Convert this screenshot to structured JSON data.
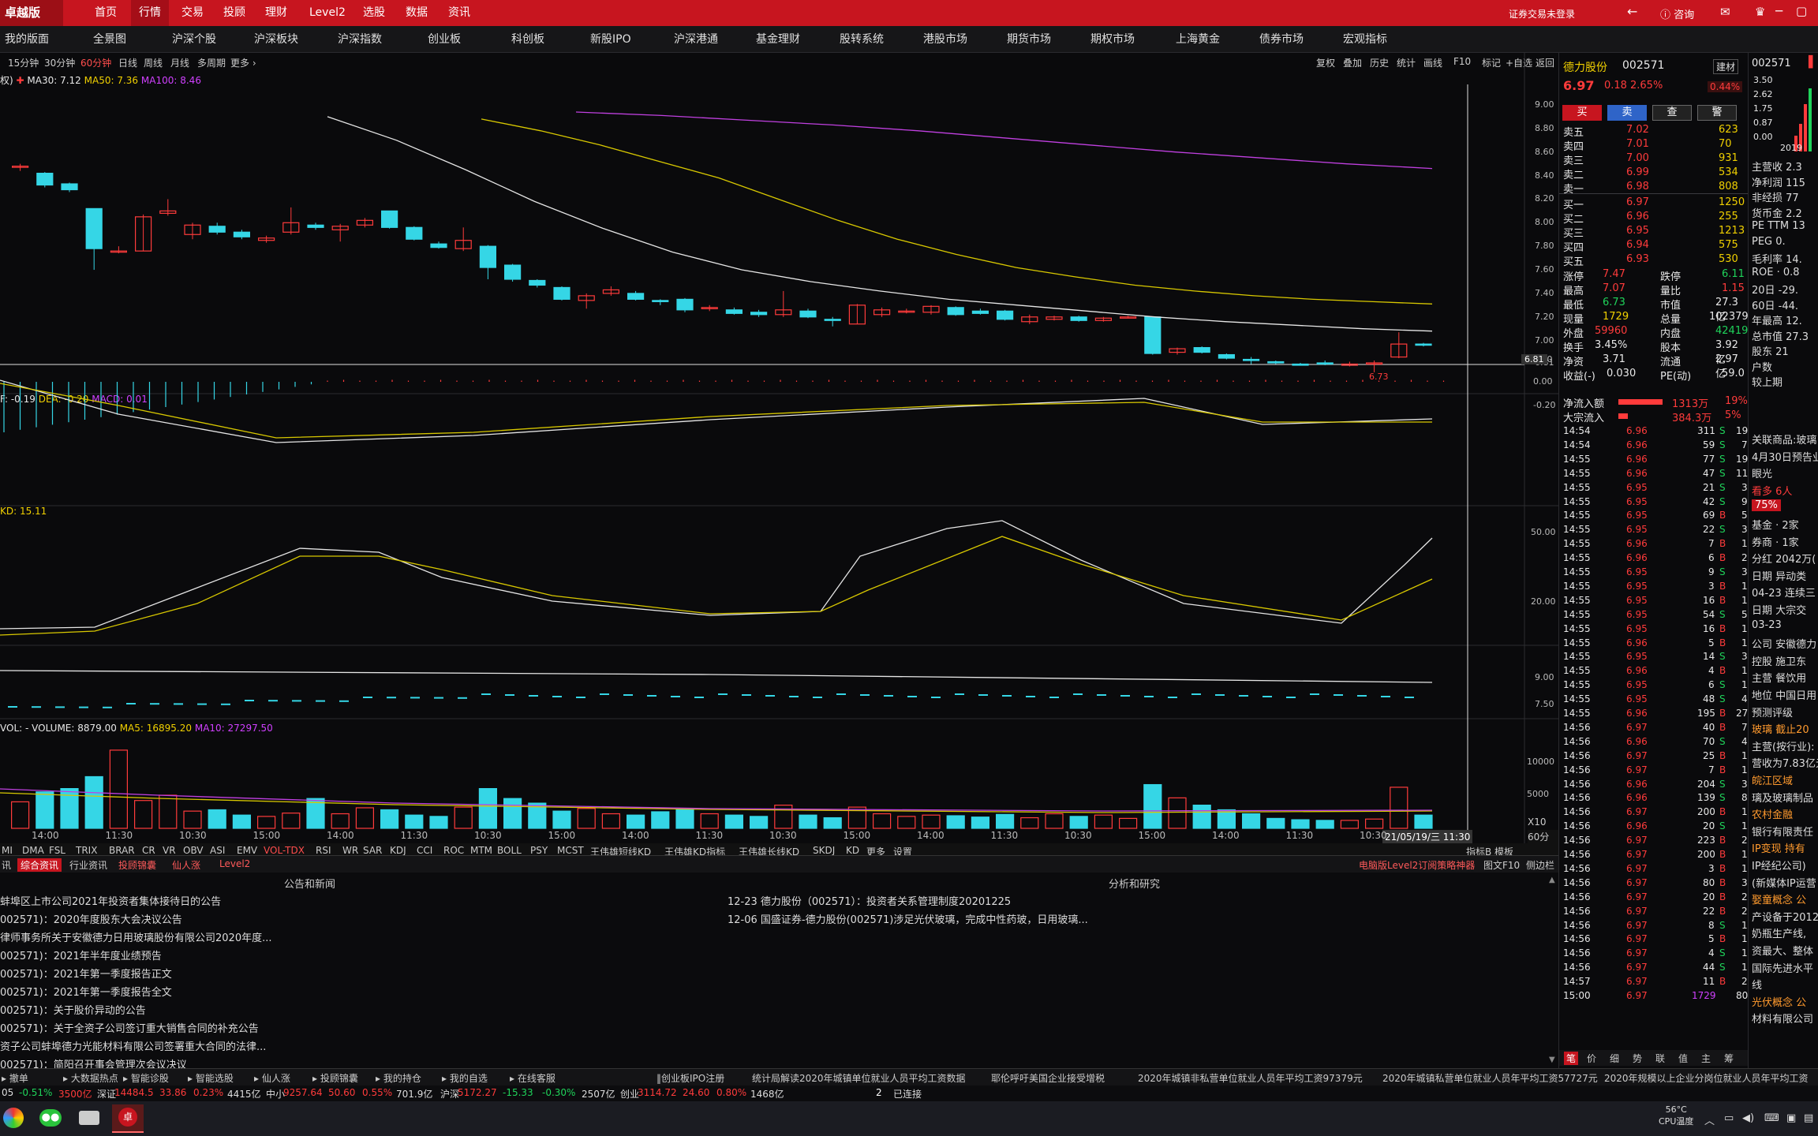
{
  "app": {
    "logo": "卓越版",
    "menu": [
      "首页",
      "行情",
      "交易",
      "投顾",
      "理财",
      "Level2",
      "选股",
      "数据",
      "资讯"
    ],
    "active_menu": "行情",
    "login_text": "证券交易未登录",
    "consult": "咨询"
  },
  "nav": [
    "我的版面",
    "全景图",
    "沪深个股",
    "沪深板块",
    "沪深指数",
    "创业板",
    "科创板",
    "新股IPO",
    "沪深港通",
    "基金理财",
    "股转系统",
    "港股市场",
    "期货市场",
    "期权市场",
    "上海黄金",
    "债券市场",
    "宏观指标"
  ],
  "periods": [
    "15分钟",
    "30分钟",
    "60分钟",
    "日线",
    "周线",
    "月线",
    "多周期",
    "更多 ›"
  ],
  "active_period": "60分钟",
  "chart_tools": [
    "复权",
    "叠加",
    "历史",
    "统计",
    "画线",
    "F10",
    "标记",
    "+自选",
    "返回"
  ],
  "ma_line": {
    "prefix": "权)",
    "ma30": "MA30: 7.12",
    "ma50": "MA50: 7.36",
    "ma100": "MA100: 8.46"
  },
  "macd_line": {
    "dif": "F: -0.19",
    "dea": "DEA: -0.20",
    "macd": "MACD: 0.01"
  },
  "kd_line": "KD: 15.11",
  "vol_line": {
    "vol": "VOL: - VOLUME: 8879.00",
    "ma5": "MA5: 16895.20",
    "ma10": "MA10: 27297.50"
  },
  "y_price": [
    "9.00",
    "8.80",
    "8.60",
    "8.40",
    "8.20",
    "8.00",
    "7.80",
    "7.60",
    "7.40",
    "7.20",
    "7.00",
    "6.81"
  ],
  "y_macd": [
    "0.20",
    "0.00",
    "-0.20"
  ],
  "y_kd": [
    "50.00",
    "20.00"
  ],
  "y_other": [
    "9.00",
    "7.50"
  ],
  "y_vol": [
    "10000",
    "5000"
  ],
  "vol_unit": "X10",
  "x_ticks": [
    "14:00",
    "11:30",
    "10:30",
    "15:00",
    "14:00",
    "11:30",
    "10:30",
    "15:00",
    "14:00",
    "11:30",
    "10:30",
    "15:00",
    "14:00",
    "11:30",
    "10:30",
    "15:00",
    "14:00",
    "11:30",
    "10:30"
  ],
  "crosshair_date": "21/05/19/三 11:30",
  "cross_price": "6.81",
  "low_label": "6.73",
  "period_label": "60分钟",
  "mode_tabs": [
    "指标B",
    "模板"
  ],
  "indicator_tabs": [
    "MI",
    "DMA",
    "FSL",
    "TRIX",
    "BRAR",
    "CR",
    "VR",
    "OBV",
    "ASI",
    "EMV",
    "VOL-TDX",
    "RSI",
    "WR",
    "SAR",
    "KDJ",
    "CCI",
    "ROC",
    "MTM",
    "BOLL",
    "PSY",
    "MCST",
    "王伟雄短线KD",
    "王伟雄KD指标",
    "王伟雄长线KD",
    "SKDJ",
    "KD",
    "更多",
    "设置"
  ],
  "bottom_tabs": [
    "讯",
    "综合资讯",
    "行业资讯",
    "投顾锦囊",
    "仙人涨",
    "Level2"
  ],
  "bottom_right": [
    "电脑版Level2订阅策略神器",
    "图文F10",
    "侧边栏"
  ],
  "news": {
    "left_title": "公告和新闻",
    "right_title": "分析和研究",
    "left": [
      "蚌埠区上市公司2021年投资者集体接待日的公告",
      "002571)：2020年度股东大会决议公告",
      "律师事务所关于安徽德力日用玻璃股份有限公司2020年度...",
      "002571)：2021年半年度业绩预告",
      "002571)：2021年第一季度报告正文",
      "002571)：2021年第一季度报告全文",
      "002571)：关于股价异动的公告",
      "002571)：关于全资子公司签订重大销售合同的补充公告",
      "资子公司蚌埠德力光能材料有限公司签署重大合同的法律...",
      "002571)：简阳召开事会管理次会议决议"
    ],
    "right": [
      "12-23 德力股份（002571）：投资者关系管理制度20201225",
      "12-06 国盛证券-德力股份(002571)涉足光伏玻璃，完成中性药玻，日用玻璃..."
    ]
  },
  "quote": {
    "name": "德力股份",
    "code": "002571",
    "sector": "建材",
    "price": "6.97",
    "change": "0.18",
    "pct": "2.65%",
    "side_pct": "0.44%",
    "buttons": [
      "买",
      "卖",
      "查",
      "警"
    ],
    "sell": [
      [
        "卖五",
        "7.02",
        "623"
      ],
      [
        "卖四",
        "7.01",
        "70"
      ],
      [
        "卖三",
        "7.00",
        "931"
      ],
      [
        "卖二",
        "6.99",
        "534"
      ],
      [
        "卖一",
        "6.98",
        "808"
      ]
    ],
    "buy": [
      [
        "买一",
        "6.97",
        "1250"
      ],
      [
        "买二",
        "6.96",
        "255"
      ],
      [
        "买三",
        "6.95",
        "1213"
      ],
      [
        "买四",
        "6.94",
        "575"
      ],
      [
        "买五",
        "6.93",
        "530"
      ]
    ],
    "stats": [
      [
        "涨停",
        "7.47",
        "跌停",
        "6.11"
      ],
      [
        "最高",
        "7.07",
        "量比",
        "1.15"
      ],
      [
        "最低",
        "6.73",
        "市值",
        "27.3亿"
      ],
      [
        "现量",
        "1729",
        "总量",
        "102379"
      ],
      [
        "外盘",
        "59960",
        "内盘",
        "42419"
      ],
      [
        "换手",
        "3.45%",
        "股本",
        "3.92亿"
      ],
      [
        "净资",
        "3.71",
        "流通",
        "2.97亿"
      ],
      [
        "收益(-)",
        "0.030",
        "PE(动)",
        "59.0"
      ]
    ],
    "flow": [
      [
        "净流入额",
        "1313万",
        "19%"
      ],
      [
        "大宗流入",
        "384.3万",
        "5%"
      ]
    ]
  },
  "ticks": [
    [
      "14:54",
      "6.96",
      "311",
      "S",
      "19"
    ],
    [
      "14:54",
      "6.96",
      "59",
      "S",
      "7"
    ],
    [
      "14:55",
      "6.96",
      "77",
      "S",
      "19"
    ],
    [
      "14:55",
      "6.96",
      "47",
      "S",
      "11"
    ],
    [
      "14:55",
      "6.95",
      "21",
      "S",
      "3"
    ],
    [
      "14:55",
      "6.95",
      "42",
      "S",
      "9"
    ],
    [
      "14:55",
      "6.95",
      "69",
      "B",
      "5"
    ],
    [
      "14:55",
      "6.95",
      "22",
      "S",
      "3"
    ],
    [
      "14:55",
      "6.96",
      "7",
      "B",
      "1"
    ],
    [
      "14:55",
      "6.96",
      "6",
      "B",
      "2"
    ],
    [
      "14:55",
      "6.95",
      "9",
      "S",
      "3"
    ],
    [
      "14:55",
      "6.95",
      "3",
      "B",
      "1"
    ],
    [
      "14:55",
      "6.95",
      "16",
      "B",
      "1"
    ],
    [
      "14:55",
      "6.95",
      "54",
      "S",
      "5"
    ],
    [
      "14:55",
      "6.95",
      "16",
      "B",
      "1"
    ],
    [
      "14:55",
      "6.96",
      "5",
      "B",
      "1"
    ],
    [
      "14:55",
      "6.95",
      "14",
      "S",
      "3"
    ],
    [
      "14:55",
      "6.96",
      "4",
      "B",
      "1"
    ],
    [
      "14:55",
      "6.95",
      "6",
      "S",
      "1"
    ],
    [
      "14:55",
      "6.95",
      "48",
      "S",
      "4"
    ],
    [
      "14:55",
      "6.96",
      "195",
      "B",
      "27"
    ],
    [
      "14:56",
      "6.97",
      "40",
      "B",
      "7"
    ],
    [
      "14:56",
      "6.96",
      "70",
      "S",
      "4"
    ],
    [
      "14:56",
      "6.97",
      "25",
      "B",
      "1"
    ],
    [
      "14:56",
      "6.97",
      "7",
      "B",
      "1"
    ],
    [
      "14:56",
      "6.96",
      "204",
      "S",
      "3"
    ],
    [
      "14:56",
      "6.96",
      "139",
      "S",
      "8"
    ],
    [
      "14:56",
      "6.97",
      "200",
      "B",
      "1"
    ],
    [
      "14:56",
      "6.96",
      "20",
      "S",
      "1"
    ],
    [
      "14:56",
      "6.97",
      "223",
      "B",
      "2"
    ],
    [
      "14:56",
      "6.97",
      "200",
      "B",
      "1"
    ],
    [
      "14:56",
      "6.97",
      "3",
      "B",
      "1"
    ],
    [
      "14:56",
      "6.97",
      "80",
      "B",
      "3"
    ],
    [
      "14:56",
      "6.97",
      "20",
      "B",
      "2"
    ],
    [
      "14:56",
      "6.97",
      "22",
      "B",
      "2"
    ],
    [
      "14:56",
      "6.97",
      "8",
      "S",
      "1"
    ],
    [
      "14:56",
      "6.97",
      "5",
      "B",
      "1"
    ],
    [
      "14:56",
      "6.97",
      "4",
      "S",
      "1"
    ],
    [
      "14:56",
      "6.97",
      "44",
      "S",
      "1"
    ],
    [
      "14:57",
      "6.97",
      "11",
      "B",
      "2"
    ],
    [
      "15:00",
      "6.97",
      "1729",
      "",
      "80"
    ]
  ],
  "right_tabs": [
    "笔",
    "价",
    "细",
    "势",
    "联",
    "值",
    "主",
    "筹"
  ],
  "far": {
    "code": "002571",
    "y": [
      "3.50",
      "2.62",
      "1.75",
      "0.87",
      "0.00"
    ],
    "year": "2019",
    "rows": [
      "主营收 2.3",
      "净利润 115",
      "非经损 77",
      "货币金 2.2",
      "PE TTM 13",
      "PEG 0.",
      "毛利率 14.",
      "ROE · 0.8",
      "20日 -29.",
      "60日 -44.",
      "年最高 12.",
      "总市值 27.3",
      "股东 21",
      "户数",
      "较上期"
    ],
    "extra": [
      "关联商品:玻璃",
      "4月30日预告业",
      "眼光",
      "看多 6人",
      "75%",
      "基金 · 2家",
      "券商 · 1家",
      "分红 2042万(",
      "日期 异动类",
      "04-23 连续三",
      "日期 大宗交",
      "03-23",
      "公司 安徽德力",
      "控股 施卫东",
      "主营 餐饮用",
      "地位 中国日用",
      "预测评级",
      "玻璃 截止20",
      "主营(按行业):",
      "营收为7.83亿元",
      "皖江区域",
      "璃及玻璃制品",
      "农村金融",
      "银行有限责任",
      "IP变现 持有",
      "IP经纪公司)",
      "(新媒体IP运营",
      "娶童概念 公",
      "产设备于2012",
      "奶瓶生产线,",
      "资最大、整体",
      "国际先进水平",
      "线",
      "光伏概念 公",
      "材料有限公司"
    ]
  },
  "ticker": [
    "‖创业板IPO注册",
    "统计局解读2020年城镇单位就业人员平均工资数据",
    "耶伦呼吁美国企业接受增税",
    "2020年城镇非私营单位就业人员年平均工资97379元",
    "2020年城镇私营单位就业人员年平均工资57727元",
    "2020年规模以上企业分岗位就业人员年平均工资"
  ],
  "statusbar": [
    "撤单",
    "大数据热点",
    "智能诊股",
    "智能选股",
    "仙人涨",
    "投顾锦囊",
    "我的持仓",
    "我的自选",
    "在线客服"
  ],
  "indexbar": {
    "items": [
      [
        "05",
        "-0.51%",
        "3500亿"
      ],
      [
        "深证",
        "14484.5",
        "33.86",
        "0.23%",
        "4415亿"
      ],
      [
        "中小",
        "9257.64",
        "50.60",
        "0.55%",
        "701.9亿"
      ],
      [
        "沪深",
        "5172.27",
        "-15.33",
        "-0.30%",
        "2507亿"
      ],
      [
        "创业",
        "3114.72",
        "24.60",
        "0.80%",
        "1468亿"
      ]
    ],
    "connected": "已连接",
    "two": "2"
  },
  "tray": {
    "temp": "56°C",
    "cpu": "CPU温度"
  },
  "colors": {
    "up": "#ff3b3b",
    "down": "#35d6e6",
    "ma30": "#e6e6e6",
    "ma50": "#d8c800",
    "ma100": "#c040e0",
    "brand": "#c7151f"
  },
  "candles": [
    {
      "o": 8.48,
      "c": 8.48,
      "h": 8.5,
      "l": 8.44
    },
    {
      "o": 8.42,
      "c": 8.32,
      "h": 8.43,
      "l": 8.3
    },
    {
      "o": 8.33,
      "c": 8.28,
      "h": 8.34,
      "l": 8.26
    },
    {
      "o": 8.12,
      "c": 7.78,
      "h": 8.12,
      "l": 7.6
    },
    {
      "o": 7.76,
      "c": 7.76,
      "h": 7.8,
      "l": 7.74
    },
    {
      "o": 7.76,
      "c": 8.05,
      "h": 8.07,
      "l": 7.76
    },
    {
      "o": 8.08,
      "c": 8.1,
      "h": 8.2,
      "l": 8.06
    },
    {
      "o": 7.9,
      "c": 7.98,
      "h": 8.0,
      "l": 7.86
    },
    {
      "o": 7.97,
      "c": 7.92,
      "h": 8.0,
      "l": 7.9
    },
    {
      "o": 7.92,
      "c": 7.88,
      "h": 7.94,
      "l": 7.86
    },
    {
      "o": 7.85,
      "c": 7.87,
      "h": 7.89,
      "l": 7.83
    },
    {
      "o": 7.92,
      "c": 8.0,
      "h": 8.13,
      "l": 7.9
    },
    {
      "o": 7.98,
      "c": 7.96,
      "h": 8.0,
      "l": 7.94
    },
    {
      "o": 7.94,
      "c": 7.97,
      "h": 7.99,
      "l": 7.84
    },
    {
      "o": 7.98,
      "c": 8.02,
      "h": 8.04,
      "l": 7.96
    },
    {
      "o": 8.1,
      "c": 7.96,
      "h": 8.1,
      "l": 7.95
    },
    {
      "o": 7.96,
      "c": 7.86,
      "h": 7.97,
      "l": 7.85
    },
    {
      "o": 7.82,
      "c": 7.79,
      "h": 7.84,
      "l": 7.78
    },
    {
      "o": 7.78,
      "c": 7.85,
      "h": 7.96,
      "l": 7.76
    },
    {
      "o": 7.8,
      "c": 7.62,
      "h": 7.81,
      "l": 7.52
    },
    {
      "o": 7.64,
      "c": 7.52,
      "h": 7.65,
      "l": 7.5
    },
    {
      "o": 7.51,
      "c": 7.47,
      "h": 7.52,
      "l": 7.45
    },
    {
      "o": 7.45,
      "c": 7.35,
      "h": 7.46,
      "l": 7.34
    },
    {
      "o": 7.34,
      "c": 7.38,
      "h": 7.4,
      "l": 7.27
    },
    {
      "o": 7.4,
      "c": 7.43,
      "h": 7.46,
      "l": 7.38
    },
    {
      "o": 7.4,
      "c": 7.35,
      "h": 7.42,
      "l": 7.34
    },
    {
      "o": 7.34,
      "c": 7.33,
      "h": 7.35,
      "l": 7.3
    },
    {
      "o": 7.35,
      "c": 7.26,
      "h": 7.36,
      "l": 7.24
    },
    {
      "o": 7.28,
      "c": 7.28,
      "h": 7.3,
      "l": 7.25
    },
    {
      "o": 7.26,
      "c": 7.23,
      "h": 7.28,
      "l": 7.22
    },
    {
      "o": 7.24,
      "c": 7.22,
      "h": 7.26,
      "l": 7.2
    },
    {
      "o": 7.22,
      "c": 7.26,
      "h": 7.42,
      "l": 7.2
    },
    {
      "o": 7.25,
      "c": 7.2,
      "h": 7.27,
      "l": 7.19
    },
    {
      "o": 7.18,
      "c": 7.17,
      "h": 7.2,
      "l": 7.12
    },
    {
      "o": 7.14,
      "c": 7.3,
      "h": 7.31,
      "l": 7.14
    },
    {
      "o": 7.22,
      "c": 7.26,
      "h": 7.28,
      "l": 7.2
    },
    {
      "o": 7.25,
      "c": 7.25,
      "h": 7.27,
      "l": 7.23
    },
    {
      "o": 7.24,
      "c": 7.29,
      "h": 7.3,
      "l": 7.22
    },
    {
      "o": 7.28,
      "c": 7.22,
      "h": 7.29,
      "l": 7.21
    },
    {
      "o": 7.25,
      "c": 7.23,
      "h": 7.27,
      "l": 7.22
    },
    {
      "o": 7.25,
      "c": 7.18,
      "h": 7.26,
      "l": 7.17
    },
    {
      "o": 7.16,
      "c": 7.2,
      "h": 7.22,
      "l": 7.14
    },
    {
      "o": 7.18,
      "c": 7.2,
      "h": 7.21,
      "l": 7.17
    },
    {
      "o": 7.2,
      "c": 7.17,
      "h": 7.21,
      "l": 7.16
    },
    {
      "o": 7.17,
      "c": 7.19,
      "h": 7.2,
      "l": 7.16
    },
    {
      "o": 7.2,
      "c": 7.2,
      "h": 7.21,
      "l": 7.19
    },
    {
      "o": 7.2,
      "c": 6.89,
      "h": 7.2,
      "l": 6.88
    },
    {
      "o": 6.9,
      "c": 6.93,
      "h": 6.94,
      "l": 6.88
    },
    {
      "o": 6.94,
      "c": 6.9,
      "h": 6.95,
      "l": 6.89
    },
    {
      "o": 6.88,
      "c": 6.85,
      "h": 6.89,
      "l": 6.84
    },
    {
      "o": 6.84,
      "c": 6.83,
      "h": 6.86,
      "l": 6.8
    },
    {
      "o": 6.82,
      "c": 6.81,
      "h": 6.83,
      "l": 6.8
    },
    {
      "o": 6.8,
      "c": 6.79,
      "h": 6.81,
      "l": 6.79
    },
    {
      "o": 6.81,
      "c": 6.8,
      "h": 6.83,
      "l": 6.79
    },
    {
      "o": 6.8,
      "c": 6.8,
      "h": 6.82,
      "l": 6.78
    },
    {
      "o": 6.8,
      "c": 6.81,
      "h": 6.83,
      "l": 6.73
    },
    {
      "o": 6.86,
      "c": 6.97,
      "h": 7.07,
      "l": 6.85
    },
    {
      "o": 6.97,
      "c": 6.96,
      "h": 6.98,
      "l": 6.95
    }
  ],
  "vols": [
    4000,
    5500,
    6000,
    7800,
    11800,
    4200,
    5000,
    2600,
    2800,
    2000,
    1800,
    2300,
    4500,
    2200,
    3100,
    2800,
    2000,
    1800,
    3200,
    6000,
    4500,
    3800,
    2600,
    3000,
    2200,
    2000,
    2500,
    2800,
    2200,
    2000,
    1800,
    3500,
    2000,
    1600,
    3200,
    2200,
    1800,
    2000,
    1900,
    1700,
    2100,
    1600,
    2200,
    1800,
    2000,
    1500,
    6600,
    4600,
    3500,
    2800,
    2200,
    1500,
    1300,
    1200,
    1200,
    1400,
    6200,
    2000
  ]
}
